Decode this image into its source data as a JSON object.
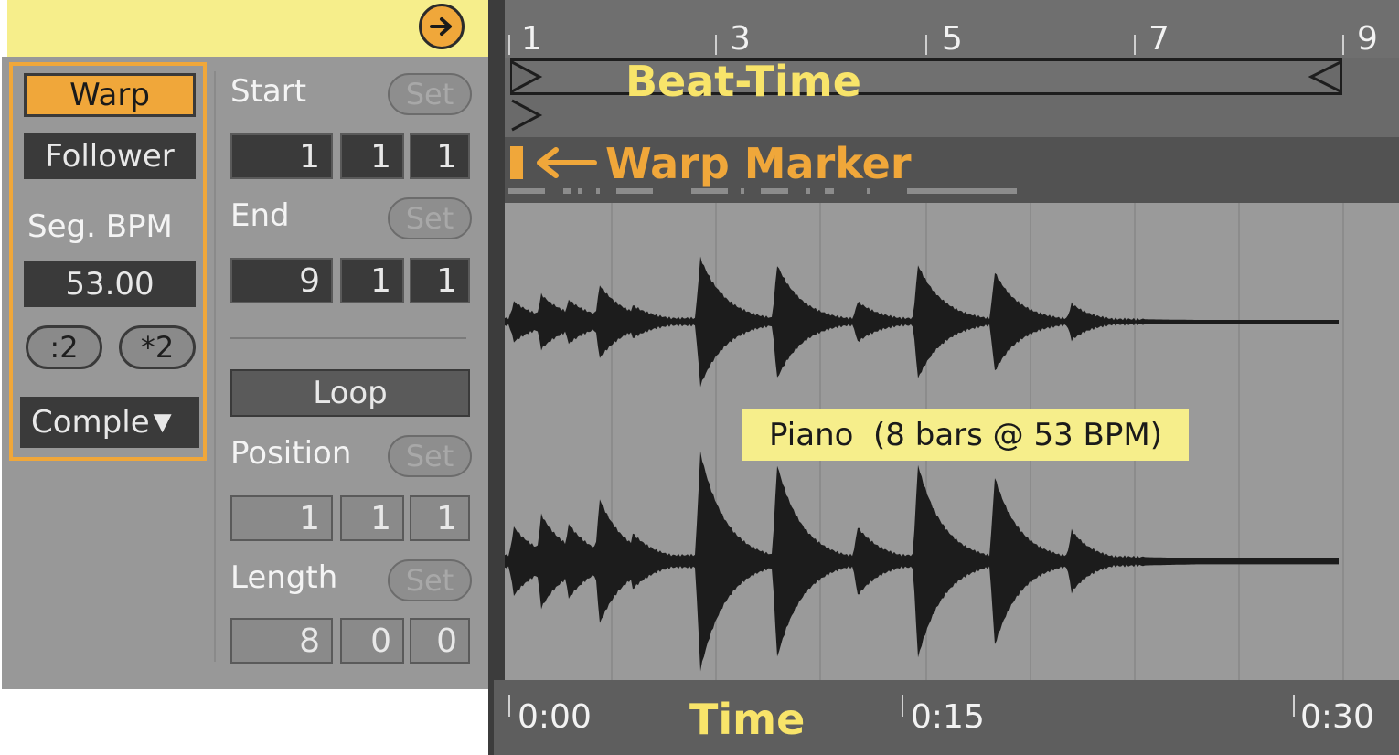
{
  "left_panel": {
    "warp_label": "Warp",
    "mode_label": "Follower",
    "seg_bpm_label": "Seg. BPM",
    "seg_bpm_value": "53.00",
    "half_label": ":2",
    "double_label": "*2",
    "algorithm_label": "Comple"
  },
  "clip": {
    "start_label": "Start",
    "start_values": [
      "1",
      "1",
      "1"
    ],
    "end_label": "End",
    "end_values": [
      "9",
      "1",
      "1"
    ],
    "set_label": "Set",
    "loop_label": "Loop",
    "position_label": "Position",
    "position_values": [
      "1",
      "1",
      "1"
    ],
    "length_label": "Length",
    "length_values": [
      "8",
      "0",
      "0"
    ]
  },
  "ruler": {
    "bars": [
      "1",
      "3",
      "5",
      "7",
      "9"
    ]
  },
  "annotations": {
    "beat_time": "Beat-Time",
    "warp_marker": "Warp Marker",
    "time": "Time",
    "clip_name": "Piano  (8 bars @ 53 BPM)"
  },
  "time_ruler": {
    "labels": [
      "0:00",
      "0:15",
      "0:30"
    ]
  },
  "colors": {
    "accent": "#f0a73a",
    "highlight": "#f6ee8b",
    "annotation_text": "#f8e46a"
  }
}
